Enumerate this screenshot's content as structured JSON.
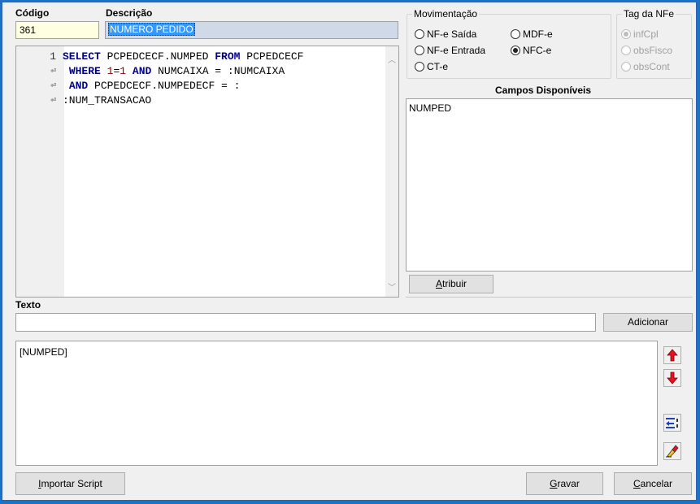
{
  "codigo": {
    "label": "Código",
    "value": "361"
  },
  "descricao": {
    "label": "Descrição",
    "value": "NUMERO PEDIDO"
  },
  "editor": {
    "lines": [
      {
        "gutter": "1",
        "wrap": false,
        "tokens": [
          [
            "kw",
            "SELECT"
          ],
          [
            "t",
            " PCPEDCECF.NUMPED "
          ],
          [
            "kw",
            "FROM"
          ],
          [
            "t",
            " PCPEDCECF"
          ]
        ]
      },
      {
        "gutter": "",
        "wrap": true,
        "tokens": [
          [
            "t",
            " "
          ],
          [
            "kw",
            "WHERE"
          ],
          [
            "t",
            " "
          ],
          [
            "num",
            "1"
          ],
          [
            "t",
            "="
          ],
          [
            "num",
            "1"
          ],
          [
            "t",
            " "
          ],
          [
            "kw",
            "AND"
          ],
          [
            "t",
            " NUMCAIXA = :NUMCAIXA"
          ]
        ]
      },
      {
        "gutter": "",
        "wrap": true,
        "tokens": [
          [
            "t",
            " "
          ],
          [
            "kw",
            "AND"
          ],
          [
            "t",
            " PCPEDCECF.NUMPEDECF = :"
          ]
        ]
      },
      {
        "gutter": "",
        "wrap": true,
        "tokens": [
          [
            "t",
            ":NUM_TRANSACAO"
          ]
        ]
      }
    ]
  },
  "movimentacao": {
    "title": "Movimentação",
    "options": [
      {
        "label": "NF-e Saída",
        "checked": false
      },
      {
        "label": "NF-e Entrada",
        "checked": false
      },
      {
        "label": "CT-e",
        "checked": false
      },
      {
        "label": "MDF-e",
        "checked": false
      },
      {
        "label": "NFC-e",
        "checked": true
      }
    ]
  },
  "tag_nfe": {
    "title": "Tag da NFe",
    "options": [
      {
        "label": "infCpl",
        "checked": true
      },
      {
        "label": "obsFisco",
        "checked": false
      },
      {
        "label": "obsCont",
        "checked": false
      }
    ]
  },
  "campos": {
    "title": "Campos Disponíveis",
    "items": [
      "NUMPED"
    ]
  },
  "atribuir": {
    "label_u": "A",
    "label_rest": "tribuir"
  },
  "texto": {
    "label": "Texto",
    "value": ""
  },
  "adicionar": {
    "label": "Adicionar"
  },
  "output": {
    "text": "[NUMPED]"
  },
  "buttons": {
    "importar_u": "I",
    "importar_rest": "mportar Script",
    "gravar_u": "G",
    "gravar_rest": "ravar",
    "cancelar_u": "C",
    "cancelar_rest": "ancelar"
  },
  "colors": {
    "selection": "#3399ff",
    "codigo_bg": "#ffffe1",
    "up_arrow": "#e81123",
    "down_arrow": "#e81123"
  }
}
